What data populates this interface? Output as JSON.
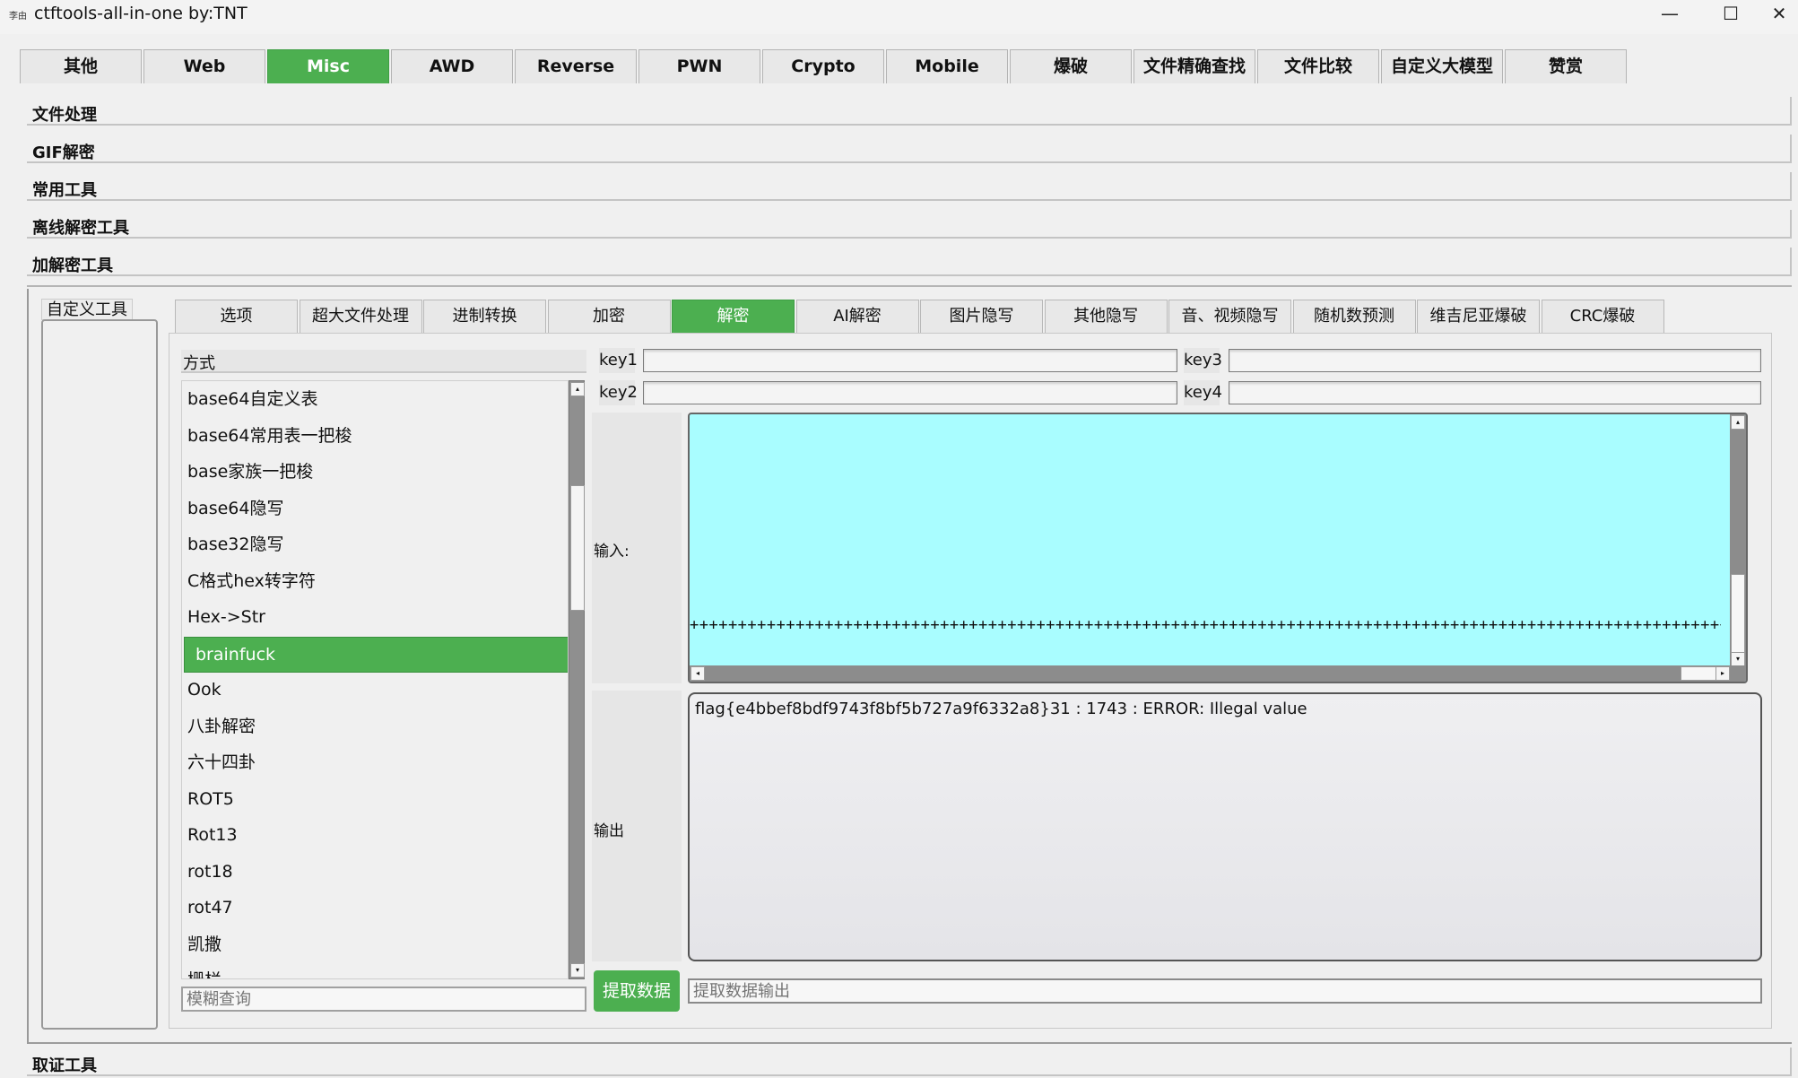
{
  "window": {
    "icon_text": "李由",
    "title": "ctftools-all-in-one   by:TNT",
    "controls": [
      "—",
      "☐",
      "✕"
    ]
  },
  "top_tabs": [
    "其他",
    "Web",
    "Misc",
    "AWD",
    "Reverse",
    "PWN",
    "Crypto",
    "Mobile",
    "爆破",
    "文件精确查找",
    "文件比较",
    "自定义大模型",
    "赞赏"
  ],
  "active_top_tab": "Misc",
  "sections": [
    "文件处理",
    "GIF解密",
    "常用工具",
    "离线解密工具",
    "加解密工具"
  ],
  "bottom_section": "取证工具",
  "custom_tools_label": "自定义工具",
  "sub_tabs": [
    "选项",
    "超大文件处理",
    "进制转换",
    "加密",
    "解密",
    "AI解密",
    "图片隐写",
    "其他隐写",
    "音、视频隐写",
    "随机数预测",
    "维吉尼亚爆破",
    "CRC爆破"
  ],
  "active_sub_tab": "解密",
  "method_header": "方式",
  "methods": [
    "base64自定义表",
    "base64常用表一把梭",
    "base家族一把梭",
    "base64隐写",
    "base32隐写",
    "C格式hex转字符",
    "Hex->Str",
    "brainfuck",
    "Ook",
    "八卦解密",
    "六十四卦",
    "ROT5",
    "Rot13",
    "rot18",
    "rot47",
    "凯撒",
    "栅栏"
  ],
  "selected_method": "brainfuck",
  "filter_placeholder": "模糊查询",
  "keys": {
    "key1": "key1",
    "key2": "key2",
    "key3": "key3",
    "key4": "key4"
  },
  "input_label": "输入:",
  "input_text": "++++++++++++++++++++++++++++++++++++++++++++++++++++++++++++++++++++++++++++++++++++++++++++++++++++++++++++++++++++++++++++++++++++++.",
  "output_label": "输出",
  "output_text": "flag{e4bbef8bdf9743f8bf5b727a9f6332a8}31 : 1743 : ERROR: Illegal value",
  "extract_button": "提取数据",
  "extract_placeholder": "提取数据输出",
  "colors": {
    "accent": "#4caf50",
    "input_bg": "#a9fdff"
  }
}
